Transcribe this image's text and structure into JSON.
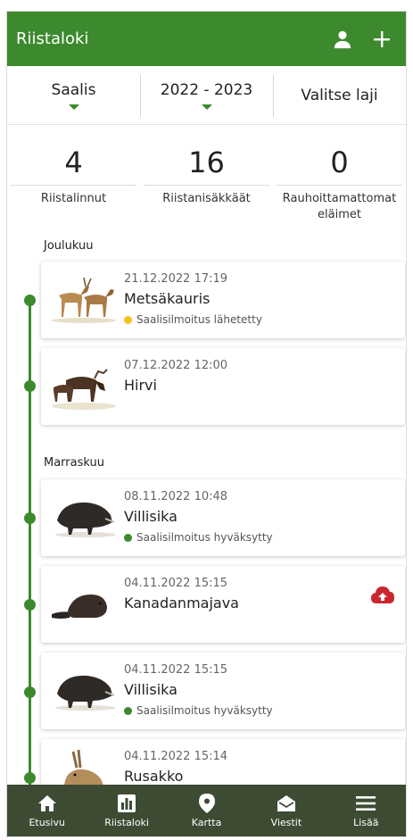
{
  "header": {
    "title": "Riistaloki"
  },
  "filters": [
    {
      "label": "Saalis",
      "has_caret": true
    },
    {
      "label": "2022 - 2023",
      "has_caret": true
    },
    {
      "label": "Valitse laji",
      "has_caret": false
    }
  ],
  "stats": [
    {
      "value": "4",
      "label": "Riistalinnut"
    },
    {
      "value": "16",
      "label": "Riistanisäkkäät"
    },
    {
      "value": "0",
      "label": "Rauhoittamattomat eläimet"
    }
  ],
  "months": [
    "Joulukuu",
    "Marraskuu"
  ],
  "entries": [
    {
      "datetime": "21.12.2022   17:19",
      "species": "Metsäkauris",
      "status": "Saalisilmoitus lähetetty",
      "status_color": "#f2c318",
      "icon": "roe-deer-image"
    },
    {
      "datetime": "07.12.2022   12:00",
      "species": "Hirvi",
      "status": "",
      "icon": "moose-image"
    },
    {
      "datetime": "08.11.2022   10:48",
      "species": "Villisika",
      "status": "Saalisilmoitus hyväksytty",
      "status_color": "#3d8a2e",
      "icon": "wild-boar-image"
    },
    {
      "datetime": "04.11.2022   15:15",
      "species": "Kanadanmajava",
      "status": "",
      "icon": "beaver-image",
      "upload_icon": "cloud-upload-icon",
      "upload_color": "#c8282d"
    },
    {
      "datetime": "04.11.2022   15:15",
      "species": "Villisika",
      "status": "Saalisilmoitus hyväksytty",
      "status_color": "#3d8a2e",
      "icon": "wild-boar-image"
    },
    {
      "datetime": "04.11.2022   15:14",
      "species": "Rusakko",
      "status": "",
      "icon": "hare-image"
    }
  ],
  "tabs": [
    {
      "label": "Etusivu",
      "icon": "home-icon"
    },
    {
      "label": "Riistaloki",
      "icon": "bar-chart-icon",
      "active": true
    },
    {
      "label": "Kartta",
      "icon": "map-pin-icon"
    },
    {
      "label": "Viestit",
      "icon": "mail-icon"
    },
    {
      "label": "Lisää",
      "icon": "menu-icon"
    }
  ],
  "colors": {
    "primary": "#3d8a2e",
    "tabbar": "#3d4b33",
    "pending": "#f2c318",
    "upload": "#c8282d"
  }
}
